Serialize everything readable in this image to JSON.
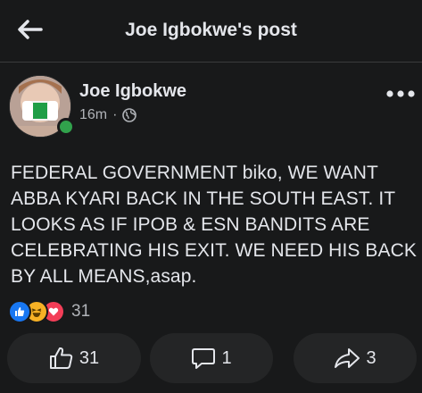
{
  "header": {
    "title": "Joe Igbokwe's post",
    "back_icon": "arrow-left-icon"
  },
  "post": {
    "author": "Joe Igbokwe",
    "time": "16m",
    "separator": "·",
    "audience_icon": "globe-icon",
    "online_status_color": "#31a24c",
    "text": "FEDERAL GOVERNMENT biko, WE WANT ABBA KYARI BACK IN THE  SOUTH EAST. IT LOOKS AS IF IPOB & ESN BANDITS ARE CELEBRATING HIS EXIT. WE NEED HIS BACK BY ALL MEANS,asap.",
    "more_icon": "more-horizontal-icon"
  },
  "reactions": {
    "icons": [
      "like-icon",
      "haha-icon",
      "love-icon"
    ],
    "count": "31"
  },
  "actions": {
    "like": {
      "icon": "thumbs-up-icon",
      "count": "31"
    },
    "comment": {
      "icon": "comment-icon",
      "count": "1"
    },
    "share": {
      "icon": "share-icon",
      "count": "3"
    }
  },
  "colors": {
    "background": "#18191a",
    "button_background": "#242526",
    "like_blue": "#1877f2",
    "love_red": "#f33e58",
    "haha_yellow": "#f7b125"
  }
}
